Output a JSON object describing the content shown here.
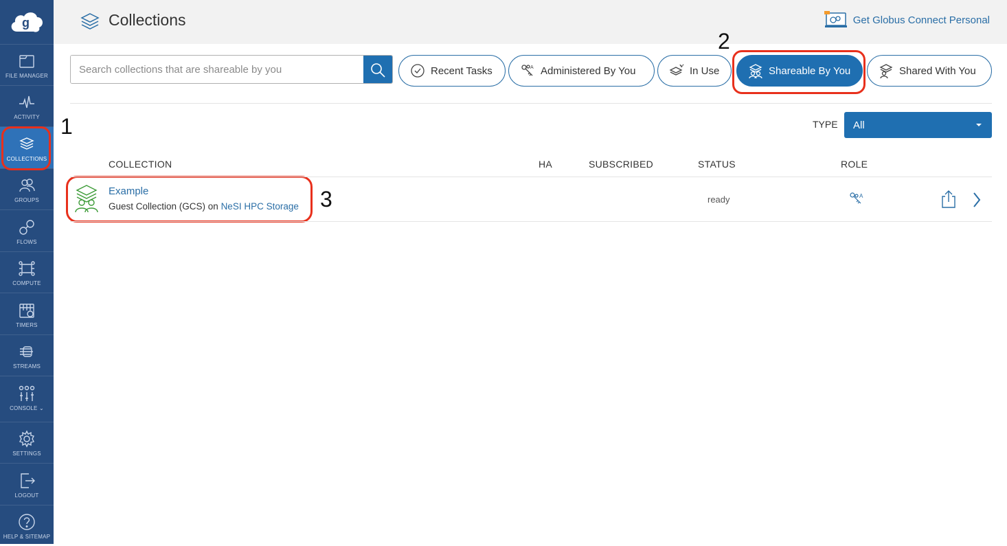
{
  "sidebar": {
    "logo_icon": "globus-logo-icon",
    "items": [
      {
        "label": "FILE MANAGER",
        "icon": "file-manager-icon",
        "active": false
      },
      {
        "label": "ACTIVITY",
        "icon": "activity-icon",
        "active": false
      },
      {
        "label": "COLLECTIONS",
        "icon": "collections-icon",
        "active": true
      },
      {
        "label": "GROUPS",
        "icon": "groups-icon",
        "active": false
      },
      {
        "label": "FLOWS",
        "icon": "flows-icon",
        "active": false
      },
      {
        "label": "COMPUTE",
        "icon": "compute-icon",
        "active": false
      },
      {
        "label": "TIMERS",
        "icon": "timers-icon",
        "active": false
      },
      {
        "label": "STREAMS",
        "icon": "streams-icon",
        "active": false
      },
      {
        "label": "CONSOLE",
        "icon": "console-icon",
        "active": false
      },
      {
        "label": "SETTINGS",
        "icon": "settings-icon",
        "active": false
      },
      {
        "label": "LOGOUT",
        "icon": "logout-icon",
        "active": false
      },
      {
        "label": "HELP & SITEMAP",
        "icon": "help-icon",
        "active": false
      }
    ]
  },
  "header": {
    "title": "Collections",
    "gcp_link": "Get Globus Connect Personal"
  },
  "search": {
    "placeholder": "Search collections that are shareable by you"
  },
  "filters": [
    {
      "label": "Recent Tasks",
      "icon": "clock-check-icon",
      "active": false
    },
    {
      "label": "Administered By You",
      "icon": "admin-keys-icon",
      "active": false
    },
    {
      "label": "In Use",
      "icon": "in-use-icon",
      "active": false
    },
    {
      "label": "Shareable By You",
      "icon": "shareable-icon",
      "active": true
    },
    {
      "label": "Shared With You",
      "icon": "shared-with-icon",
      "active": false
    }
  ],
  "type_filter": {
    "label": "TYPE",
    "value": "All"
  },
  "table": {
    "headers": [
      "COLLECTION",
      "HA",
      "SUBSCRIBED",
      "STATUS",
      "ROLE"
    ],
    "rows": [
      {
        "name": "Example",
        "subtitle_prefix": "Guest Collection (GCS) on ",
        "host": "NeSI HPC Storage",
        "status": "ready",
        "role_icon": "administrator-role-icon"
      }
    ]
  },
  "annotations": {
    "callouts": [
      "1",
      "2",
      "3"
    ]
  },
  "colors": {
    "sidebar_bg": "#264c7f",
    "accent": "#1f6fb1",
    "link": "#2a6ea6",
    "highlight": "#e8301c",
    "collection_icon": "#3a9a35"
  }
}
